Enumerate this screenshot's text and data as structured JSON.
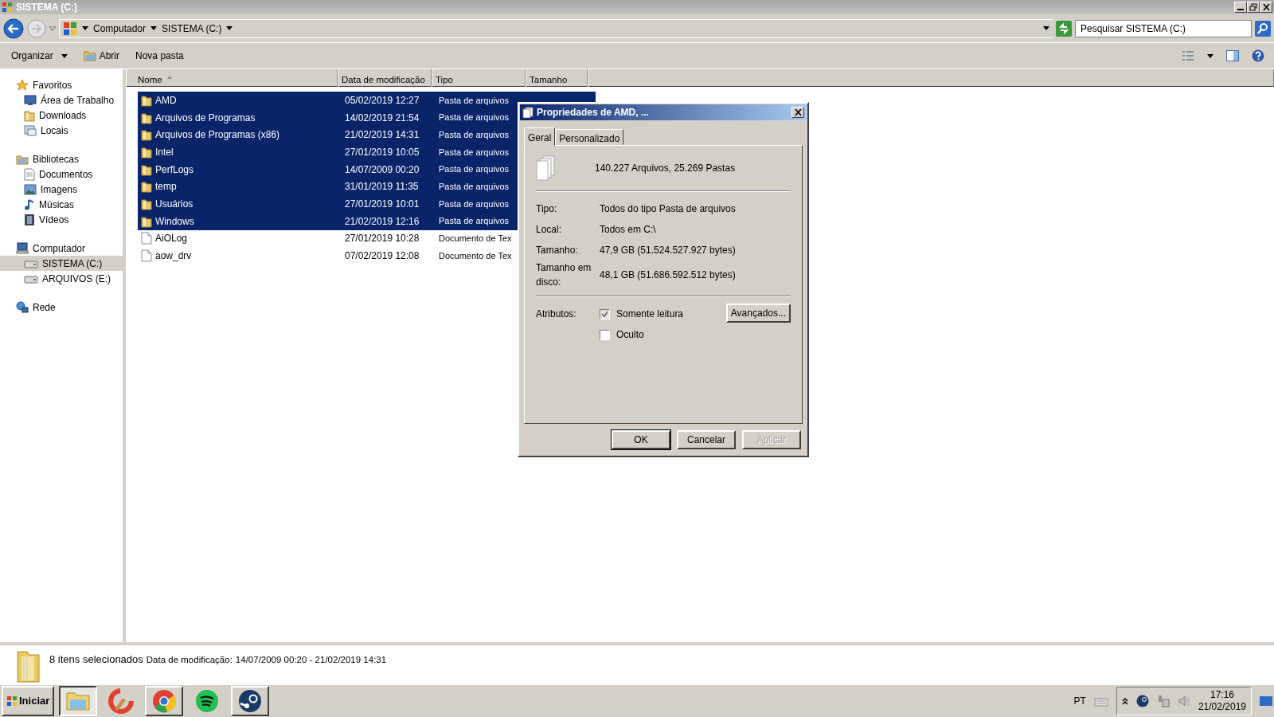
{
  "window": {
    "title": "SISTEMA (C:)"
  },
  "address": {
    "breadcrumbs": [
      "Computador",
      "SISTEMA (C:)"
    ],
    "search_placeholder": "Pesquisar SISTEMA (C:)"
  },
  "toolbar": [
    {
      "label": "Organizar",
      "kind": "menu"
    },
    {
      "label": "Abrir",
      "kind": "icon"
    },
    {
      "label": "Nova pasta",
      "kind": "plain"
    }
  ],
  "sidebar": [
    {
      "label": "Favoritos",
      "selected": false,
      "children": [
        {
          "label": "Área de Trabalho",
          "selected": false
        },
        {
          "label": "Downloads",
          "selected": false
        },
        {
          "label": "Locais",
          "selected": false
        }
      ]
    },
    {
      "label": "Bibliotecas",
      "selected": false,
      "children": [
        {
          "label": "Documentos",
          "selected": false
        },
        {
          "label": "Imagens",
          "selected": false
        },
        {
          "label": "Músicas",
          "selected": false
        },
        {
          "label": "Vídeos",
          "selected": false
        }
      ]
    },
    {
      "label": "Computador",
      "selected": false,
      "children": [
        {
          "label": "SISTEMA (C:)",
          "selected": true
        },
        {
          "label": "ARQUIVOS (E:)",
          "selected": false
        }
      ]
    },
    {
      "label": "Rede",
      "selected": false
    }
  ],
  "table": {
    "columns": [
      "Nome",
      "Data de modificação",
      "Tipo",
      "Tamanho"
    ],
    "rows": [
      {
        "name": "AMD",
        "date": "05/02/2019 12:27",
        "type": "Pasta de arquivos",
        "kind": "folder",
        "selected": true
      },
      {
        "name": "Arquivos de Programas",
        "date": "14/02/2019 21:54",
        "type": "Pasta de arquivos",
        "kind": "folder",
        "selected": true
      },
      {
        "name": "Arquivos de Programas (x86)",
        "date": "21/02/2019 14:31",
        "type": "Pasta de arquivos",
        "kind": "folder",
        "selected": true
      },
      {
        "name": "Intel",
        "date": "27/01/2019 10:05",
        "type": "Pasta de arquivos",
        "kind": "folder",
        "selected": true
      },
      {
        "name": "PerfLogs",
        "date": "14/07/2009 00:20",
        "type": "Pasta de arquivos",
        "kind": "folder",
        "selected": true
      },
      {
        "name": "temp",
        "date": "31/01/2019 11:35",
        "type": "Pasta de arquivos",
        "kind": "folder",
        "selected": true
      },
      {
        "name": "Usuários",
        "date": "27/01/2019 10:01",
        "type": "Pasta de arquivos",
        "kind": "folder",
        "selected": true
      },
      {
        "name": "Windows",
        "date": "21/02/2019 12:16",
        "type": "Pasta de arquivos",
        "kind": "folder",
        "selected": true
      },
      {
        "name": "AiOLog",
        "date": "27/01/2019 10:28",
        "type": "Documento de Tex",
        "kind": "file",
        "selected": false
      },
      {
        "name": "aow_drv",
        "date": "07/02/2019 12:08",
        "type": "Documento de Tex",
        "kind": "file",
        "selected": false
      }
    ]
  },
  "dialog": {
    "title": "Propriedades de AMD, ...",
    "tabs": [
      {
        "label": "Geral",
        "selected": true
      },
      {
        "label": "Personalizado",
        "selected": false
      }
    ],
    "summary": "140.227 Arquivos, 25.269 Pastas",
    "properties": [
      {
        "label": "Tipo:",
        "value": "Todos do tipo Pasta de arquivos"
      },
      {
        "label": "Local:",
        "value": "Todos em C:\\"
      },
      {
        "label": "Tamanho:",
        "value": "47,9 GB (51.524.527.927 bytes)"
      },
      {
        "label": "Tamanho em disco:",
        "value": "48,1 GB (51.686.592.512 bytes)"
      }
    ],
    "attributes_label": "Atributos:",
    "attributes": [
      {
        "label": "Somente leitura",
        "checked": true
      },
      {
        "label": "Oculto",
        "checked": false
      }
    ],
    "advanced_button": "Avançados...",
    "buttons": [
      {
        "label": "OK",
        "disabled": false
      },
      {
        "label": "Cancelar",
        "disabled": false
      },
      {
        "label": "Aplicar",
        "disabled": true
      }
    ]
  },
  "details": {
    "count": "8 itens selecionados",
    "label": "Data de modificação:",
    "value": "14/07/2009 00:20 - 21/02/2019 14:31"
  },
  "taskbar": {
    "start": "Iniciar",
    "apps": [
      {
        "kind": "explorer",
        "running": true
      },
      {
        "kind": "cleaner",
        "running": false
      },
      {
        "kind": "browser",
        "running": true
      },
      {
        "kind": "music",
        "running": false
      },
      {
        "kind": "steam",
        "running": true
      }
    ],
    "language": "PT",
    "time": "17:16",
    "date": "21/02/2019"
  }
}
